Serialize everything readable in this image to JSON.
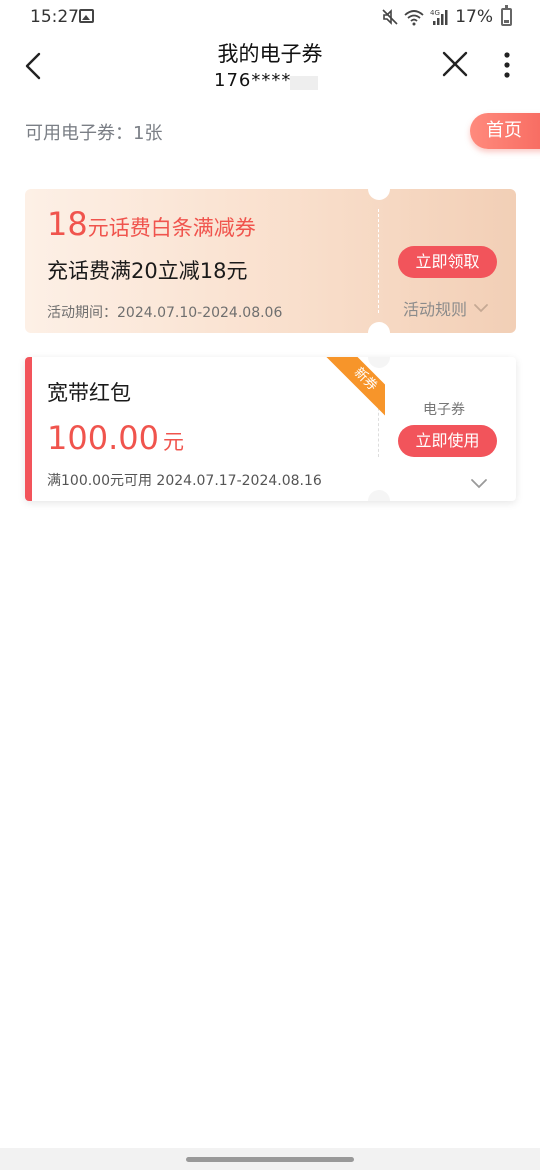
{
  "status_bar": {
    "time": "15:27",
    "battery": "17%",
    "network": "4G",
    "icons": [
      "image-icon",
      "mute-icon",
      "wifi-icon",
      "signal-icon",
      "battery-icon"
    ]
  },
  "nav": {
    "title": "我的电子券",
    "subtitle": "176****.",
    "icons": [
      "back-icon",
      "close-icon",
      "more-icon"
    ]
  },
  "summary": {
    "count_label": "可用电子券：1张",
    "home_label": "首页"
  },
  "coupons": [
    {
      "amount": "18",
      "title": "元话费白条满减券",
      "description": "充话费满20立减18元",
      "period": "活动期间：2024.07.10-2024.08.06",
      "action": "立即领取",
      "rules": "活动规则"
    },
    {
      "name": "宽带红包",
      "amount": "100.00",
      "unit": "元",
      "condition": "满100.00元可用 2024.07.17-2024.08.16",
      "type": "电子券",
      "action": "立即使用",
      "badge": "新券"
    }
  ],
  "colors": {
    "accent": "#f2545b",
    "amount": "#f0544d",
    "badge": "#f7952a"
  }
}
